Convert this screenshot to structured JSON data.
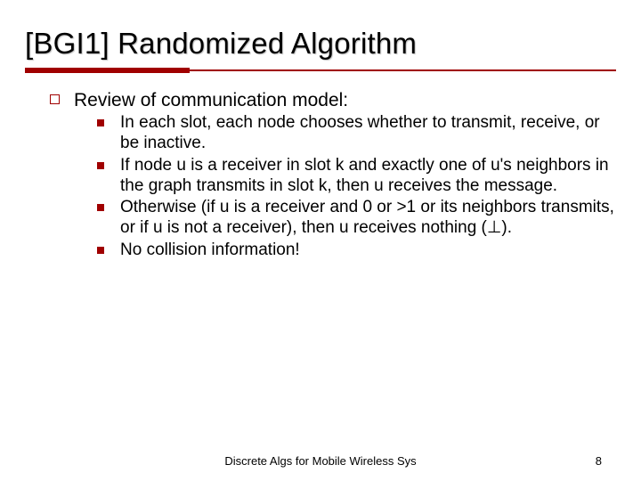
{
  "title_prefix": "[BGI1]",
  "title_rest": " Randomized Algorithm",
  "main": {
    "heading": "Review of communication model:",
    "items": [
      "In each slot, each node chooses whether to transmit, receive, or be inactive.",
      "If node u is a receiver in slot k and exactly one of u's neighbors in the graph transmits in slot k, then u receives the message.",
      "Otherwise (if u is a receiver and 0 or >1 or its neighbors transmits, or if u is not a receiver), then u receives nothing (⊥).",
      "No collision information!"
    ]
  },
  "footer": {
    "center": "Discrete Algs for Mobile Wireless Sys",
    "page": "8"
  }
}
